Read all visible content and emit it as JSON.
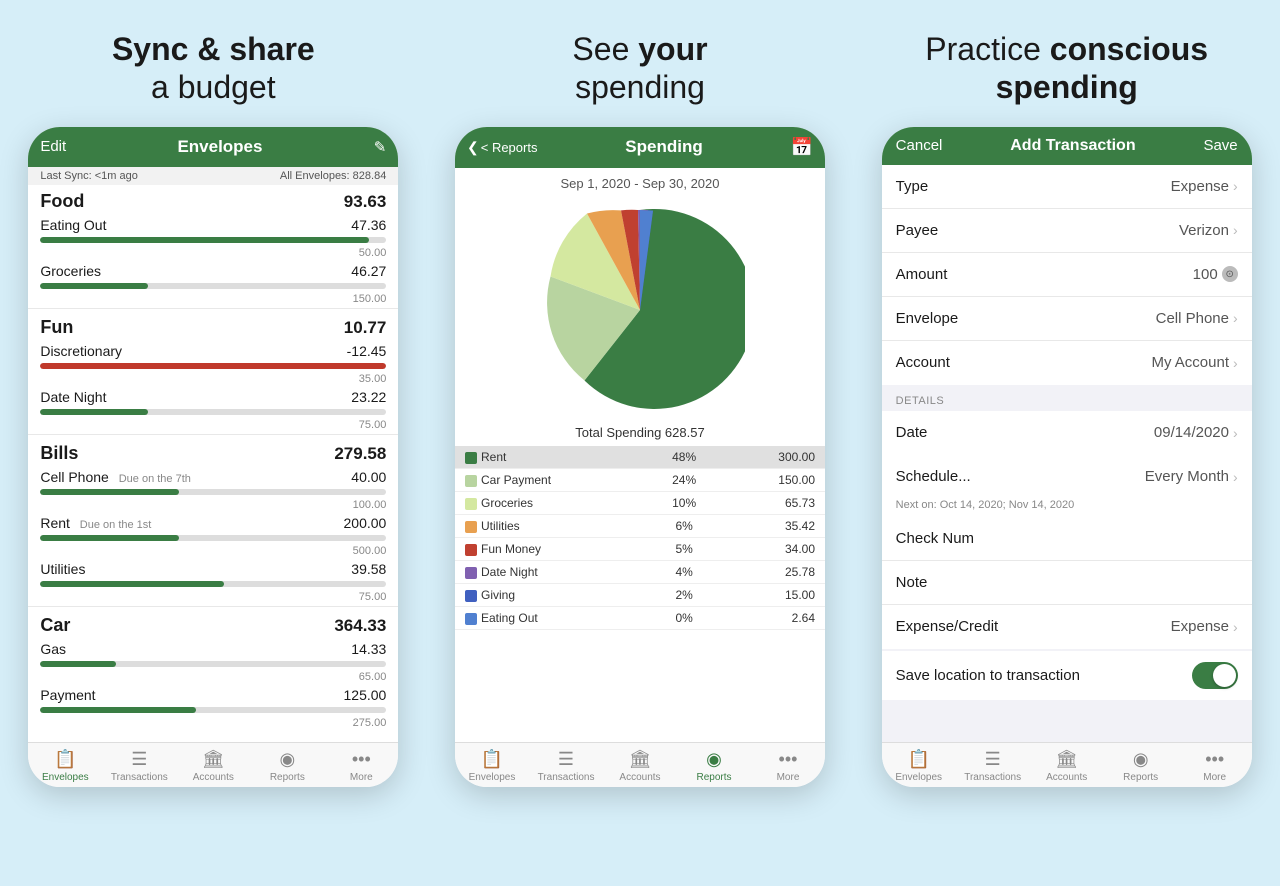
{
  "panel1": {
    "title": "Sync & share\na budget",
    "header": {
      "edit": "Edit",
      "title": "Envelopes",
      "icon": "✎"
    },
    "sync_bar": {
      "left": "Last Sync: <1m ago",
      "right": "All Envelopes: 828.84"
    },
    "groups": [
      {
        "name": "Food",
        "amount": "93.63",
        "items": [
          {
            "name": "Eating Out",
            "due": "",
            "amount": "47.36",
            "budget": "50.00",
            "pct": 95,
            "color": "green"
          },
          {
            "name": "Groceries",
            "due": "",
            "amount": "46.27",
            "budget": "150.00",
            "pct": 31,
            "color": "green"
          }
        ]
      },
      {
        "name": "Fun",
        "amount": "10.77",
        "items": [
          {
            "name": "Discretionary",
            "due": "",
            "amount": "-12.45",
            "budget": "35.00",
            "pct": 100,
            "color": "red"
          },
          {
            "name": "Date Night",
            "due": "",
            "amount": "23.22",
            "budget": "75.00",
            "pct": 31,
            "color": "green"
          }
        ]
      },
      {
        "name": "Bills",
        "amount": "279.58",
        "items": [
          {
            "name": "Cell Phone",
            "due": "Due on the 7th",
            "amount": "40.00",
            "budget": "100.00",
            "pct": 40,
            "color": "green"
          },
          {
            "name": "Rent",
            "due": "Due on the 1st",
            "amount": "200.00",
            "budget": "500.00",
            "pct": 40,
            "color": "green"
          },
          {
            "name": "Utilities",
            "due": "",
            "amount": "39.58",
            "budget": "75.00",
            "pct": 53,
            "color": "green"
          }
        ]
      },
      {
        "name": "Car",
        "amount": "364.33",
        "items": [
          {
            "name": "Gas",
            "due": "",
            "amount": "14.33",
            "budget": "65.00",
            "pct": 22,
            "color": "green"
          },
          {
            "name": "Payment",
            "due": "",
            "amount": "125.00",
            "budget": "275.00",
            "pct": 45,
            "color": "green"
          }
        ]
      }
    ],
    "tabs": [
      {
        "icon": "📋",
        "label": "Envelopes",
        "active": true
      },
      {
        "icon": "≡",
        "label": "Transactions",
        "active": false
      },
      {
        "icon": "🏛",
        "label": "Accounts",
        "active": false
      },
      {
        "icon": "◉",
        "label": "Reports",
        "active": false
      },
      {
        "icon": "•••",
        "label": "More",
        "active": false
      }
    ]
  },
  "panel2": {
    "title_prefix": "See ",
    "title_bold": "your",
    "title_line2": "spending",
    "header": {
      "back": "< Reports",
      "title": "Spending",
      "cal_icon": "📅"
    },
    "date_range": "Sep 1, 2020 - Sep 30, 2020",
    "total": "Total Spending 628.57",
    "legend": [
      {
        "label": "Rent",
        "color": "#3a7d44",
        "pct": "48%",
        "amount": "300.00",
        "highlight": true
      },
      {
        "label": "Car Payment",
        "color": "#b8d4a0",
        "pct": "24%",
        "amount": "150.00",
        "highlight": false
      },
      {
        "label": "Groceries",
        "color": "#d4e8a0",
        "pct": "10%",
        "amount": "65.73",
        "highlight": false
      },
      {
        "label": "Utilities",
        "color": "#e8a050",
        "pct": "6%",
        "amount": "35.42",
        "highlight": false
      },
      {
        "label": "Fun Money",
        "color": "#c04030",
        "pct": "5%",
        "amount": "34.00",
        "highlight": false
      },
      {
        "label": "Date Night",
        "color": "#8060b0",
        "pct": "4%",
        "amount": "25.78",
        "highlight": false
      },
      {
        "label": "Giving",
        "color": "#4060c0",
        "pct": "2%",
        "amount": "15.00",
        "highlight": false
      },
      {
        "label": "Eating Out",
        "color": "#5080d0",
        "pct": "0%",
        "amount": "2.64",
        "highlight": false
      }
    ],
    "pie_slices": [
      {
        "color": "#3a7d44",
        "pct": 48
      },
      {
        "color": "#b8d4a0",
        "pct": 24
      },
      {
        "color": "#d4e8a0",
        "pct": 10
      },
      {
        "color": "#e8a050",
        "pct": 6
      },
      {
        "color": "#c04030",
        "pct": 5
      },
      {
        "color": "#8060b0",
        "pct": 4
      },
      {
        "color": "#4060c0",
        "pct": 2
      },
      {
        "color": "#5080d0",
        "pct": 1
      }
    ],
    "tabs": [
      {
        "icon": "📋",
        "label": "Envelopes",
        "active": false
      },
      {
        "icon": "≡",
        "label": "Transactions",
        "active": false
      },
      {
        "icon": "🏛",
        "label": "Accounts",
        "active": false
      },
      {
        "icon": "◉",
        "label": "Reports",
        "active": true
      },
      {
        "icon": "•••",
        "label": "More",
        "active": false
      }
    ]
  },
  "panel3": {
    "title_prefix": "Practice ",
    "title_bold": "conscious",
    "title_line2": "spending",
    "header": {
      "cancel": "Cancel",
      "title": "Add Transaction",
      "save": "Save"
    },
    "rows": [
      {
        "label": "Type",
        "value": "Expense",
        "chevron": true
      },
      {
        "label": "Payee",
        "value": "Verizon",
        "chevron": true
      },
      {
        "label": "Amount",
        "value": "100",
        "input": true,
        "chevron": false
      },
      {
        "label": "Envelope",
        "value": "Cell Phone",
        "chevron": true
      },
      {
        "label": "Account",
        "value": "My Account",
        "chevron": true
      }
    ],
    "details_label": "DETAILS",
    "detail_rows": [
      {
        "label": "Date",
        "value": "09/14/2020",
        "chevron": true,
        "sub": ""
      },
      {
        "label": "Schedule...",
        "value": "Every Month",
        "chevron": true,
        "sub": "Next on: Oct 14, 2020; Nov 14, 2020"
      },
      {
        "label": "Check Num",
        "value": "",
        "chevron": false,
        "sub": ""
      },
      {
        "label": "Note",
        "value": "",
        "chevron": false,
        "sub": ""
      },
      {
        "label": "Expense/Credit",
        "value": "Expense",
        "chevron": true,
        "sub": ""
      }
    ],
    "location_row": {
      "label": "Save location to transaction",
      "toggle": true
    },
    "tabs": [
      {
        "icon": "📋",
        "label": "Envelopes",
        "active": false
      },
      {
        "icon": "≡",
        "label": "Transactions",
        "active": false
      },
      {
        "icon": "🏛",
        "label": "Accounts",
        "active": false
      },
      {
        "icon": "◉",
        "label": "Reports",
        "active": false
      },
      {
        "icon": "•••",
        "label": "More",
        "active": false
      }
    ]
  }
}
